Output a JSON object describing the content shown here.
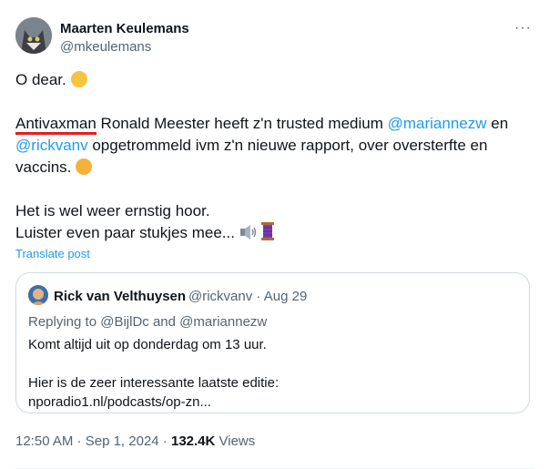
{
  "author": {
    "name": "Maarten Keulemans",
    "handle": "@mkeulemans"
  },
  "more_label": "···",
  "tweet": {
    "line1": "O dear.",
    "p2_underlined": "Antivaxman",
    "p2_text1": " Ronald Meester heeft z'n trusted medium  ",
    "mention1": "@mariannezw",
    "p2_text2": " en",
    "mention2": "@rickvanv",
    "p2_text3": " opgetrommeld ivm z'n nieuwe rapport, over oversterfte en vaccins.",
    "p3_line1": "Het is wel weer ernstig hoor.",
    "p3_line2": "Luister even paar stukjes mee...",
    "emojis": [
      "face-with-rolling-eyes",
      "tired-face",
      "speaker",
      "spool-of-thread"
    ]
  },
  "translate_label": "Translate post",
  "quote": {
    "name": "Rick van Velthuysen",
    "handle": "@rickvanv",
    "separator": " · ",
    "date": "Aug 29",
    "reply_prefix": "Replying to ",
    "reply_user1": "@BijlDc",
    "reply_and": " and ",
    "reply_user2": "@mariannezw",
    "line1": "Komt altijd uit op donderdag om 13 uur.",
    "line2": "Hier is de zeer interessante laatste editie:",
    "line3": "nporadio1.nl/podcasts/op-zn..."
  },
  "footer": {
    "time": "12:50 AM",
    "separator": " · ",
    "date": "Sep 1, 2024",
    "views_count": "132.4K",
    "views_label": " Views"
  },
  "colors": {
    "link": "#1d9bf0",
    "underline": "#e0201e",
    "secondary": "#536471"
  }
}
